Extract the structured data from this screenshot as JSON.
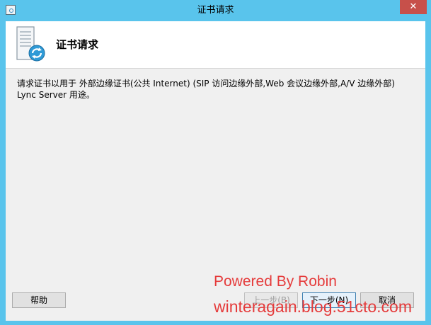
{
  "window": {
    "title": "证书请求",
    "close_glyph": "✕"
  },
  "header": {
    "title": "证书请求",
    "icon": "certificate-server-icon"
  },
  "main": {
    "description": "请求证书以用于 外部边缘证书(公共 Internet) (SIP 访问边缘外部,Web 会议边缘外部,A/V 边缘外部) Lync Server 用途。"
  },
  "buttons": {
    "help": "帮助",
    "prev": "上一步(B)",
    "next": "下一步(N)",
    "cancel": "取消"
  },
  "watermark": {
    "line1": "Powered By Robin",
    "line2": "winteragain.blog.51cto.com"
  },
  "colors": {
    "frame": "#59c4ec",
    "close": "#c7504a",
    "watermark": "#e53b3b"
  }
}
